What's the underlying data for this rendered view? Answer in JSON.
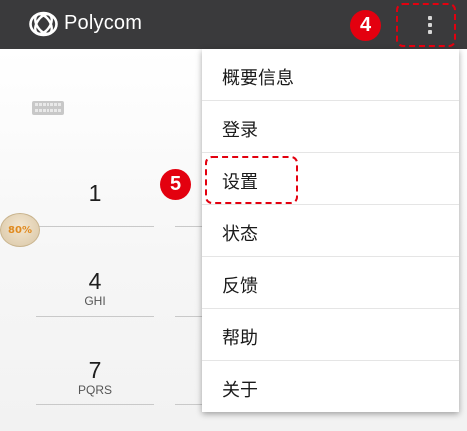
{
  "app_bar": {
    "brand": "Polycom",
    "overflow_icon": "more-vert-icon"
  },
  "annotations": {
    "step_4": "4",
    "step_5": "5"
  },
  "dialer": {
    "keyboard_icon": "keyboard-icon",
    "keys": [
      {
        "digit": "1",
        "letters": ""
      },
      {
        "digit": "4",
        "letters": "GHI"
      },
      {
        "digit": "7",
        "letters": "PQRS"
      }
    ],
    "progress_badge": "80%"
  },
  "menu": {
    "items": [
      {
        "label": "概要信息"
      },
      {
        "label": "登录"
      },
      {
        "label": "设置"
      },
      {
        "label": "状态"
      },
      {
        "label": "反馈"
      },
      {
        "label": "帮助"
      },
      {
        "label": "关于"
      }
    ]
  },
  "colors": {
    "app_bar": "#3a3a3c",
    "annotation_red": "#e3000f",
    "menu_bg": "#ffffff"
  }
}
